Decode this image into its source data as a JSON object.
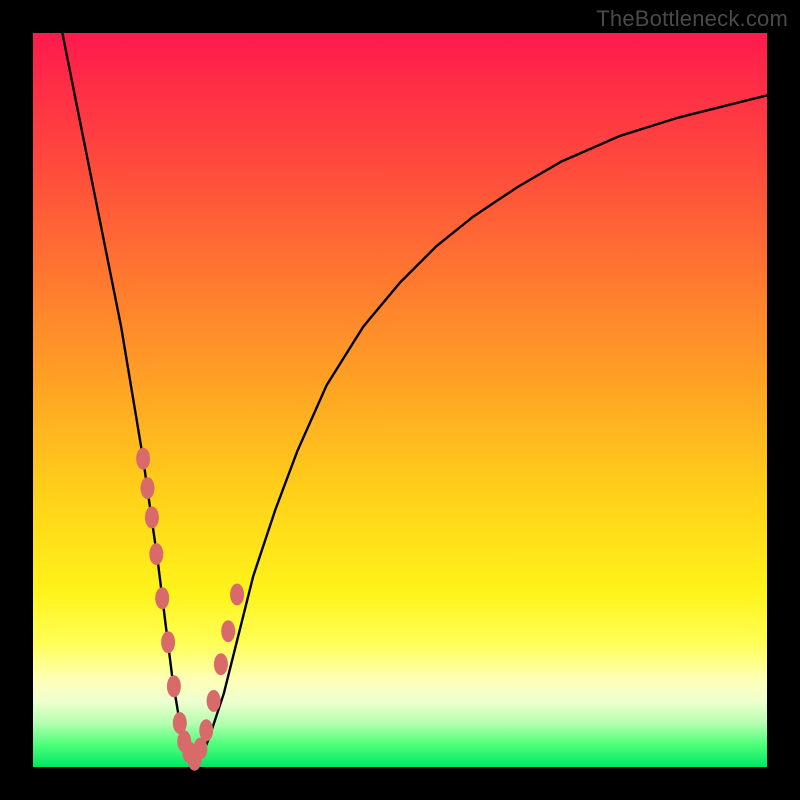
{
  "watermark": "TheBottleneck.com",
  "chart_data": {
    "type": "line",
    "title": "",
    "xlabel": "",
    "ylabel": "",
    "xlim": [
      0,
      100
    ],
    "ylim": [
      0,
      100
    ],
    "series": [
      {
        "name": "bottleneck-curve",
        "x": [
          4,
          6,
          8,
          10,
          12,
          14,
          15,
          16,
          17,
          18,
          19,
          20,
          21,
          22,
          23,
          24,
          26,
          28,
          30,
          33,
          36,
          40,
          45,
          50,
          55,
          60,
          66,
          72,
          80,
          88,
          96,
          100
        ],
        "values": [
          100,
          90,
          80,
          70,
          60,
          48,
          42,
          35,
          28,
          20,
          12,
          6,
          3,
          1,
          1.5,
          4,
          10,
          18,
          26,
          35,
          43,
          52,
          60,
          66,
          71,
          75,
          79,
          82.5,
          86,
          88.5,
          90.5,
          91.5
        ]
      }
    ],
    "markers": {
      "name": "highlight-points",
      "color": "#d96a6a",
      "x": [
        15.0,
        15.6,
        16.2,
        16.8,
        17.6,
        18.4,
        19.2,
        20.0,
        20.6,
        21.3,
        22.0,
        22.8,
        23.6,
        24.6,
        25.6,
        26.6,
        27.8
      ],
      "values": [
        42.0,
        38.0,
        34.0,
        29.0,
        23.0,
        17.0,
        11.0,
        6.0,
        3.5,
        2.0,
        1.0,
        2.5,
        5.0,
        9.0,
        14.0,
        18.5,
        23.5
      ]
    }
  }
}
